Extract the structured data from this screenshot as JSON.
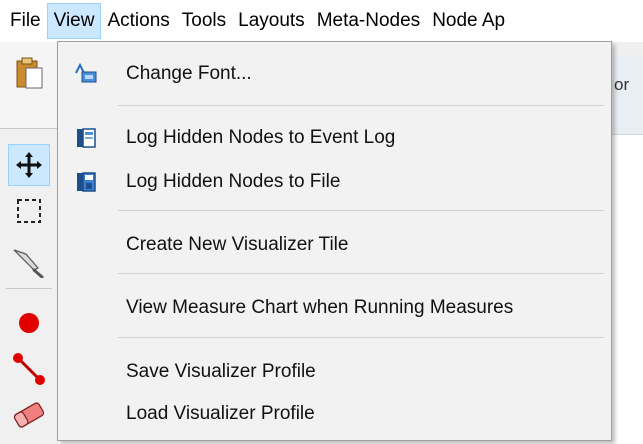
{
  "menubar": {
    "items": [
      {
        "label": "File"
      },
      {
        "label": "View"
      },
      {
        "label": "Actions"
      },
      {
        "label": "Tools"
      },
      {
        "label": "Layouts"
      },
      {
        "label": "Meta-Nodes"
      },
      {
        "label": "Node Ap"
      }
    ]
  },
  "background": {
    "partial_text": "or"
  },
  "view_menu": {
    "items": [
      {
        "label": "Change Font...",
        "icon": "change-font-icon"
      },
      {
        "label": "Log Hidden Nodes to Event Log",
        "icon": "event-log-icon"
      },
      {
        "label": "Log Hidden Nodes to File",
        "icon": "save-file-icon"
      },
      {
        "label": "Create New Visualizer Tile",
        "icon": ""
      },
      {
        "label": "View Measure Chart when Running Measures",
        "icon": ""
      },
      {
        "label": "Save Visualizer Profile",
        "icon": ""
      },
      {
        "label": "Load Visualizer Profile",
        "icon": ""
      }
    ]
  },
  "toolbar": {
    "tools": [
      {
        "icon": "paste-icon"
      },
      {
        "icon": "move-icon"
      },
      {
        "icon": "select-rectangle-icon"
      },
      {
        "icon": "scalpel-icon"
      },
      {
        "icon": "node-icon"
      },
      {
        "icon": "edge-icon"
      },
      {
        "icon": "eraser-icon"
      }
    ]
  },
  "colors": {
    "highlight": "#cce8ff",
    "highlight_border": "#99d1ff",
    "menu_bg": "#f2f2f2",
    "node_red": "#e00000"
  }
}
